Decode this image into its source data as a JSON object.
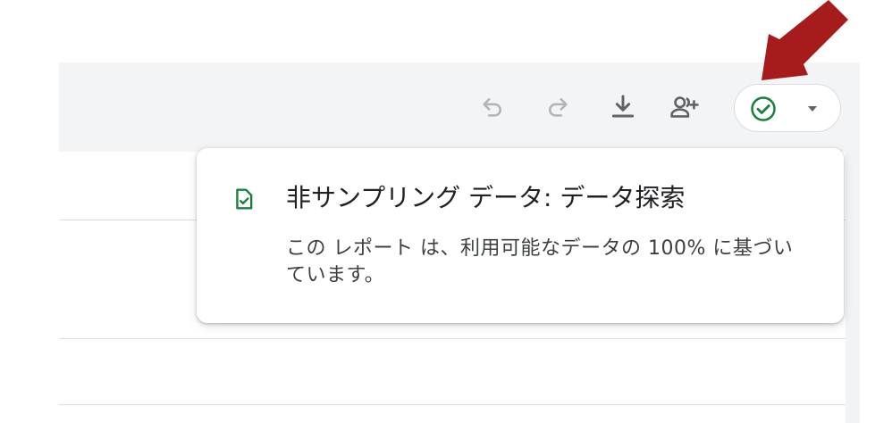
{
  "toolbar": {
    "undo_icon": "undo-icon",
    "redo_icon": "redo-icon",
    "download_icon": "download-icon",
    "share_icon": "person-add-icon",
    "status_icon": "check-circle-icon",
    "dropdown_icon": "caret-down-icon"
  },
  "popup": {
    "icon": "verified-document-icon",
    "title": "非サンプリング データ: データ探索",
    "body": "この レポート は、利用可能なデータの 100% に基づいています。"
  },
  "colors": {
    "toolbar_bg": "#f3f4f5",
    "icon_gray": "#5f6368",
    "icon_disabled": "#b0b4b8",
    "status_green": "#188038",
    "annotation_red": "#a61c1c"
  }
}
